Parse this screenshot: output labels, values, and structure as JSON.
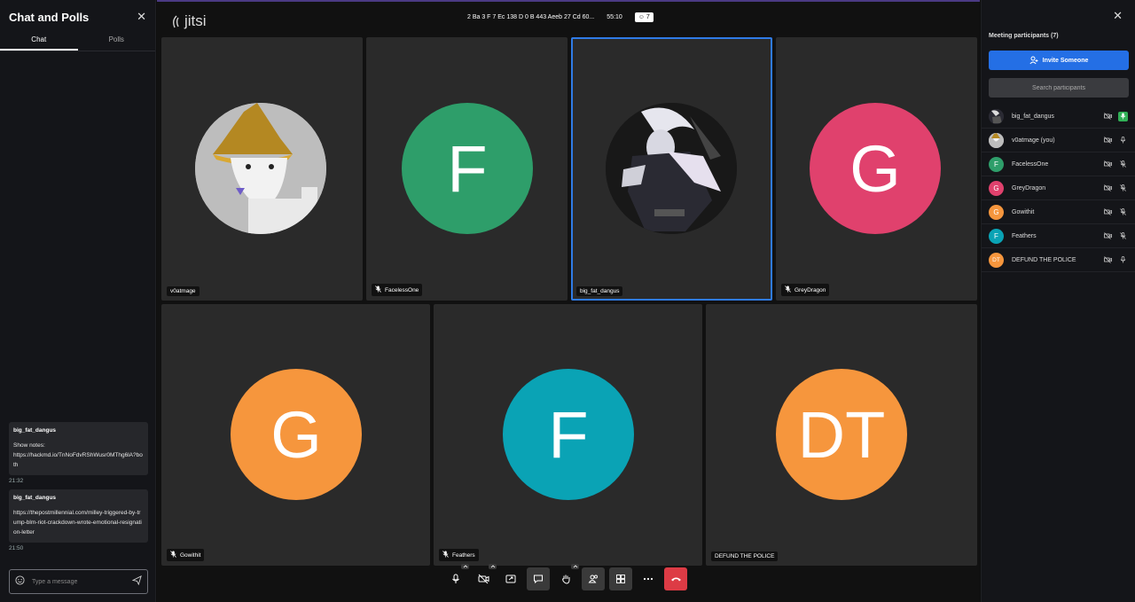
{
  "chat": {
    "title": "Chat and Polls",
    "tabs": [
      "Chat",
      "Polls"
    ],
    "messages": [
      {
        "author": "big_fat_dangus",
        "label": "Show notes:",
        "text": "https://hackmd.io/TnNoFdvRShWusr0MThg6lA?both",
        "time": "21:32"
      },
      {
        "author": "big_fat_dangus",
        "label": "",
        "text": "https://thepostmillennial.com/milley-triggered-by-trump-blm-riot-crackdown-wrote-emotional-resignation-letter",
        "time": "21:50"
      }
    ],
    "composer_placeholder": "Type a message"
  },
  "top": {
    "logo": "jitsi",
    "room": "2 Ba 3 F 7 Ec 138 D 0 B 443 Aeeb 27 Cd 60...",
    "timer": "55:10",
    "participant_count": "7"
  },
  "tiles": [
    {
      "name": "v0atmage",
      "initials": "",
      "color": "#b9b9b9",
      "muted": false,
      "active": false
    },
    {
      "name": "FacelessOne",
      "initials": "F",
      "color": "#2e9e6a",
      "muted": true,
      "active": false
    },
    {
      "name": "big_fat_dangus",
      "initials": "",
      "color": "#1c1c1c",
      "muted": false,
      "active": true
    },
    {
      "name": "GreyDragon",
      "initials": "G",
      "color": "#e0416d",
      "muted": true,
      "active": false
    },
    {
      "name": "Gowithit",
      "initials": "G",
      "color": "#f6963d",
      "muted": true,
      "active": false
    },
    {
      "name": "Feathers",
      "initials": "F",
      "color": "#0aa3b5",
      "muted": true,
      "active": false
    },
    {
      "name": "DEFUND THE POLICE",
      "initials": "DT",
      "color": "#f6963d",
      "muted": false,
      "active": false
    }
  ],
  "toolbar": [
    "microphone",
    "camera",
    "share-screen",
    "chat",
    "raise-hand",
    "participants",
    "tile-view",
    "more",
    "hangup"
  ],
  "participants": {
    "title": "Meeting participants (7)",
    "invite_label": "Invite Someone",
    "search_placeholder": "Search participants",
    "items": [
      {
        "name": "big_fat_dangus",
        "initials": "",
        "color": "#444",
        "mic": "on"
      },
      {
        "name": "v0atmage (you)",
        "initials": "",
        "color": "#b9b9b9",
        "mic": "off-outline"
      },
      {
        "name": "FacelessOne",
        "initials": "F",
        "color": "#2e9e6a",
        "mic": "muted"
      },
      {
        "name": "GreyDragon",
        "initials": "G",
        "color": "#e0416d",
        "mic": "muted"
      },
      {
        "name": "Gowithit",
        "initials": "G",
        "color": "#f6963d",
        "mic": "muted"
      },
      {
        "name": "Feathers",
        "initials": "F",
        "color": "#0aa3b5",
        "mic": "muted"
      },
      {
        "name": "DEFUND THE POLICE",
        "initials": "DT",
        "color": "#f6963d",
        "mic": "off-outline"
      }
    ]
  },
  "colors": {
    "accent": "#246fe5",
    "hangup": "#dd3b45",
    "active_border": "#2f7be6"
  }
}
